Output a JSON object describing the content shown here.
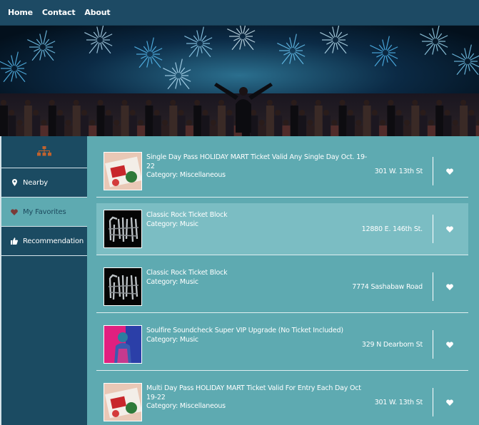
{
  "nav": {
    "links": [
      "Home",
      "Contact",
      "About"
    ]
  },
  "sidebar": {
    "logo_icon": "sitemap-icon",
    "items": [
      {
        "label": "Nearby",
        "icon": "map-marker-icon"
      },
      {
        "label": "My Favorites",
        "icon": "heart-icon",
        "active": true
      },
      {
        "label": "Recommendation",
        "icon": "thumbs-up-icon"
      }
    ]
  },
  "events": [
    {
      "title": "Single Day Pass HOLIDAY MART Ticket Valid Any Single Day Oct. 19-22",
      "category": "Category: Miscellaneous",
      "address": "301 W. 13th St",
      "thumb": "holiday"
    },
    {
      "title": "Classic Rock Ticket Block",
      "category": "Category: Music",
      "address": "12880 E. 146th St.",
      "thumb": "styx"
    },
    {
      "title": "Classic Rock Ticket Block",
      "category": "Category: Music",
      "address": "7774 Sashabaw Road",
      "thumb": "styx"
    },
    {
      "title": "Soulfire Soundcheck Super VIP Upgrade (No Ticket Included)",
      "category": "Category: Music",
      "address": "329 N Dearborn St",
      "thumb": "soulfire"
    },
    {
      "title": "Multi Day Pass HOLIDAY MART Ticket Valid For Entry Each Day Oct 19-22",
      "category": "Category: Miscellaneous",
      "address": "301 W. 13th St",
      "thumb": "holiday"
    }
  ],
  "colors": {
    "nav_bg": "#1d4a64",
    "sidebar_bg": "#1b4b62",
    "main_bg": "#5eaab1",
    "highlight_row": "#7bbdc3",
    "logo_accent": "#c0622e"
  }
}
